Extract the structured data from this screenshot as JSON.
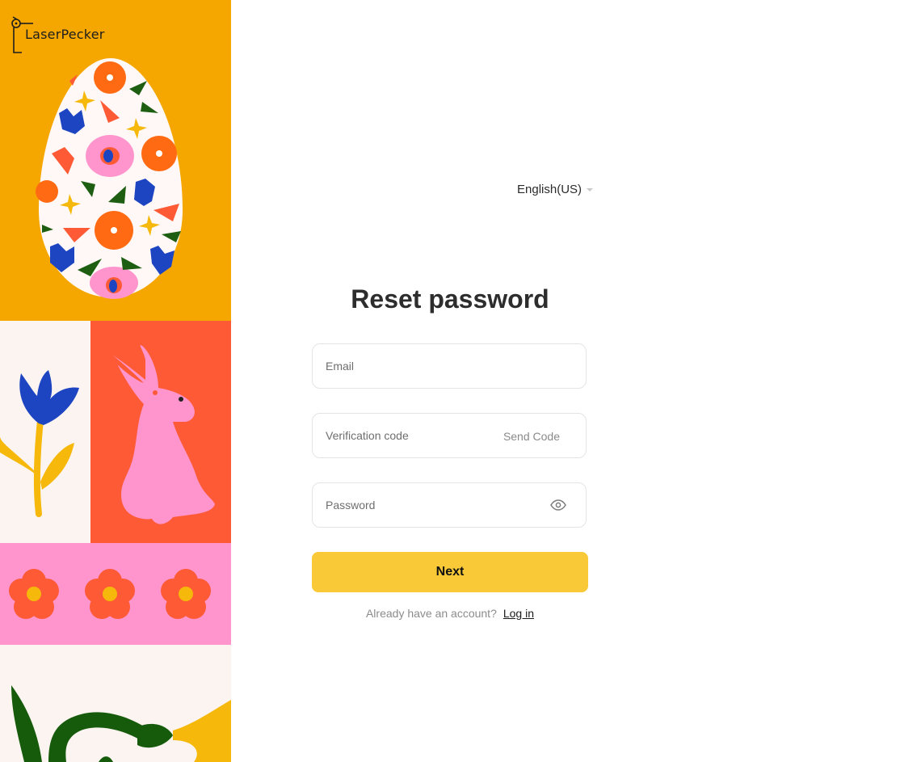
{
  "brand": {
    "name": "LaserPecker",
    "logo_icon": "woodpecker-logo-icon"
  },
  "language": {
    "selected": "English(US)"
  },
  "form": {
    "title": "Reset password",
    "email_placeholder": "Email",
    "code_placeholder": "Verification code",
    "send_code_label": "Send Code",
    "password_placeholder": "Password",
    "password_toggle_icon": "eye-icon",
    "next_label": "Next"
  },
  "footer": {
    "prompt": "Already have an account?",
    "login_label": "Log in"
  },
  "colors": {
    "accent_button": "#f9c937",
    "art_orange": "#f5a700",
    "art_red": "#ff5a36",
    "art_pink": "#ff95cc",
    "art_cream": "#fcf4f1"
  }
}
